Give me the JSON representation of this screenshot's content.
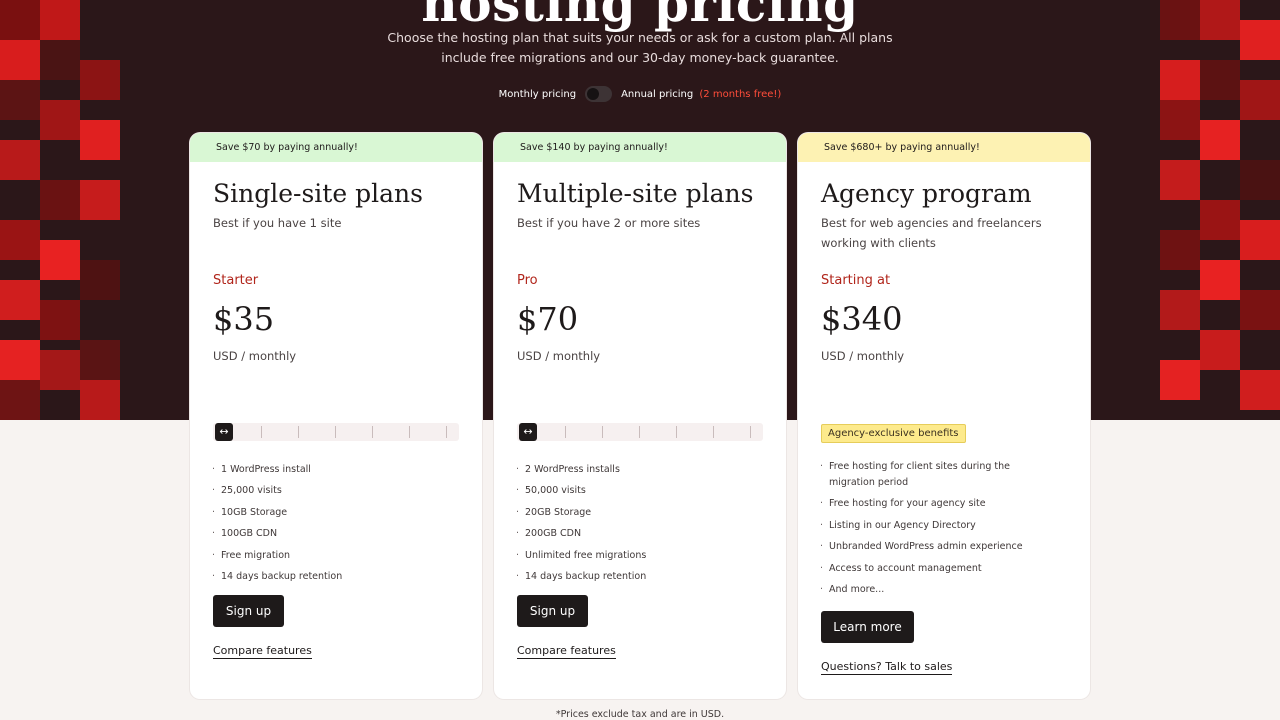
{
  "hero": {
    "title": "hosting pricing",
    "subtitle": "Choose the hosting plan that suits your needs or ask for a custom plan. All plans include free migrations and our 30-day money-back guarantee."
  },
  "pricing_toggle": {
    "monthly_label": "Monthly pricing",
    "annual_label": "Annual pricing",
    "annual_note": "(2 months free!)",
    "state": "monthly"
  },
  "plans": [
    {
      "banner": "Save $70 by paying annually!",
      "banner_color": "#d9f7d4",
      "title": "Single-site plans",
      "description": "Best if you have 1 site",
      "tier": "Starter",
      "price": "$35",
      "period": "USD / monthly",
      "features": [
        "1 WordPress install",
        "25,000 visits",
        "10GB Storage",
        "100GB CDN",
        "Free migration",
        "14 days backup retention"
      ],
      "cta": "Sign up",
      "link": "Compare features"
    },
    {
      "banner": "Save $140 by paying annually!",
      "banner_color": "#d9f7d4",
      "title": "Multiple-site plans",
      "description": "Best if you have 2 or more sites",
      "tier": "Pro",
      "price": "$70",
      "period": "USD / monthly",
      "features": [
        "2 WordPress installs",
        "50,000 visits",
        "20GB Storage",
        "200GB CDN",
        "Unlimited free migrations",
        "14 days backup retention"
      ],
      "cta": "Sign up",
      "link": "Compare features"
    },
    {
      "banner": "Save $680+ by paying annually!",
      "banner_color": "#fdf2b3",
      "title": "Agency program",
      "description": "Best for web agencies and freelancers working with clients",
      "tier": "Starting at",
      "price": "$340",
      "period": "USD / monthly",
      "badge": "Agency-exclusive benefits",
      "features": [
        "Free hosting for client sites during the migration period",
        "Free hosting for your agency site",
        "Listing in our Agency Directory",
        "Unbranded WordPress admin experience",
        "Access to account management",
        "And more..."
      ],
      "cta": "Learn more",
      "link": "Questions? Talk to sales"
    }
  ],
  "footnote": "*Prices exclude tax and are in USD.",
  "colors": {
    "hero_bg": "#2b1719",
    "accent_red": "#b1251b",
    "annual_note": "#ff4d3a",
    "button": "#1e1a1a"
  }
}
